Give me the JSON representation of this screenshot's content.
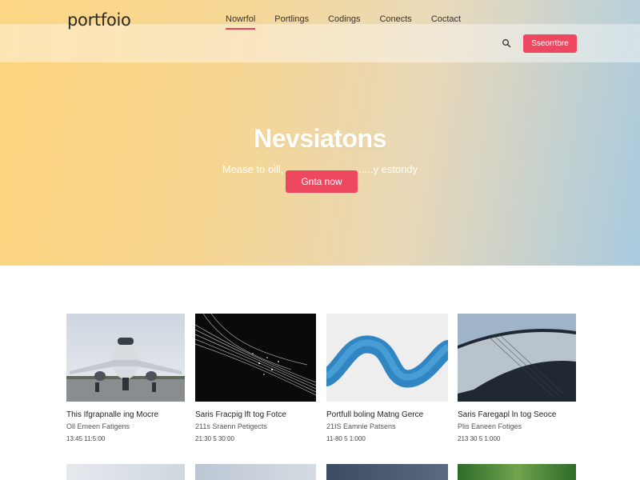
{
  "header": {
    "logo": "portfoio",
    "nav": [
      "Nowrfol",
      "Portlings",
      "Codings",
      "Conects",
      "Coctact"
    ],
    "subscribe_label": "Sseorrtbre"
  },
  "hero": {
    "title": "Nevsiatons",
    "subtitle": "Mease to oill, ..............................y estondy",
    "cta_label": "Gnta now"
  },
  "cards": [
    {
      "title": "This Ifgrapnalle ing Mocre",
      "subtitle": "Oll Emeen Fatigens",
      "meta": "13:45 11:5:00",
      "thumb": "airplane"
    },
    {
      "title": "Saris Fracpig lft tog Fotce",
      "subtitle": "211s Sraenn Petigects",
      "meta": "21:30 5 30:00",
      "thumb": "wire-streaks"
    },
    {
      "title": "Portfull boling Matng Gerce",
      "subtitle": "21IS Eamnie Patsens",
      "meta": "11-80 5 1:000",
      "thumb": "blue-tube"
    },
    {
      "title": "Saris Faregapl ln tog Seoce",
      "subtitle": "Plis Eaneen Fotiges",
      "meta": "213 30 5 1:000",
      "thumb": "metal-surface"
    }
  ]
}
